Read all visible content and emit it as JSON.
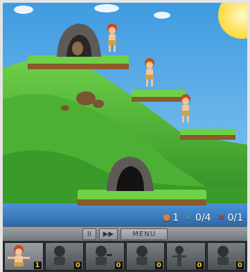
{
  "hud": {
    "saved": "1",
    "goal": "0/4",
    "lost": "0/1"
  },
  "controls": {
    "pause_symbol": "II",
    "fast_forward_symbol": "▶▶",
    "menu_label": "MENU"
  },
  "skills": [
    {
      "id": "walker",
      "count": "1"
    },
    {
      "id": "blocker",
      "count": "0"
    },
    {
      "id": "digger",
      "count": "0"
    },
    {
      "id": "builder",
      "count": "0"
    },
    {
      "id": "climber",
      "count": "0"
    },
    {
      "id": "basher",
      "count": "0"
    }
  ],
  "colors": {
    "sky": "#4fa6e6",
    "grass": "#58c23a",
    "dirt": "#8a5a2b",
    "water": "#3b7fc2",
    "goal_check": "#52d04a",
    "lost_x": "#e83a2a"
  }
}
